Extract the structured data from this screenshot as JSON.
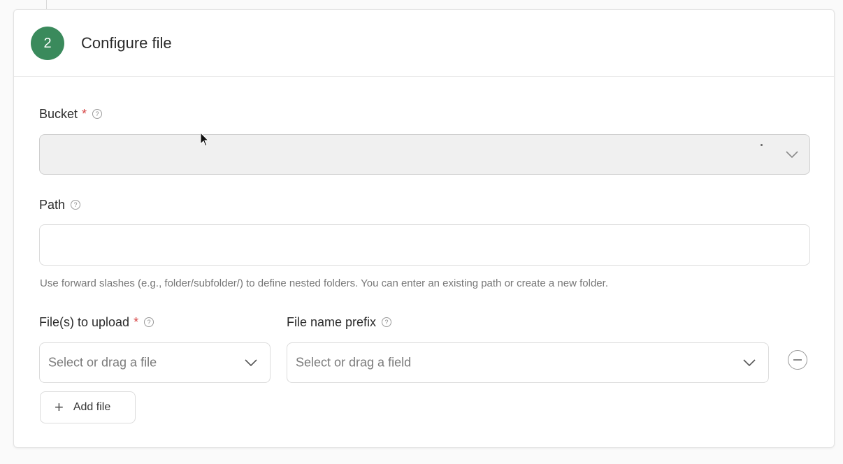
{
  "step": {
    "number": "2",
    "title": "Configure file",
    "accent_color": "#3a8a5c"
  },
  "bucket": {
    "label": "Bucket",
    "required_mark": "*",
    "help_icon": "question-circle-icon",
    "value": ""
  },
  "path": {
    "label": "Path",
    "help_icon": "question-circle-icon",
    "value": "",
    "hint": "Use forward slashes (e.g., folder/subfolder/) to define nested folders. You can enter an existing path or create a new folder."
  },
  "files": {
    "label": "File(s) to upload",
    "required_mark": "*",
    "help_icon": "question-circle-icon",
    "placeholder": "Select or drag a file"
  },
  "prefix": {
    "label": "File name prefix",
    "help_icon": "question-circle-icon",
    "placeholder": "Select or drag a field"
  },
  "add_file": {
    "label": "Add file",
    "icon": "plus-icon"
  },
  "remove_row": {
    "icon": "minus-circle-icon"
  }
}
